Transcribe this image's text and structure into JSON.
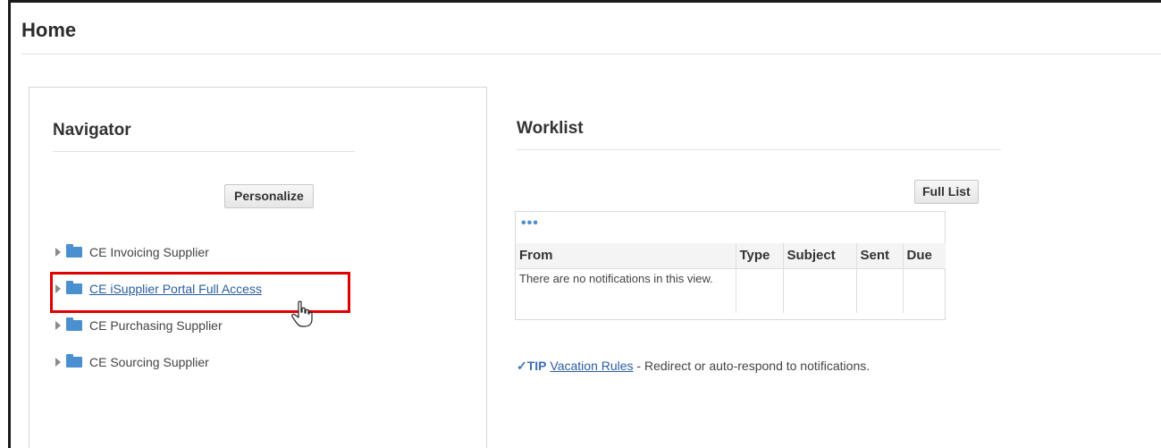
{
  "page": {
    "title": "Home"
  },
  "navigator": {
    "title": "Navigator",
    "personalize_label": "Personalize",
    "items": [
      {
        "label": "CE Invoicing Supplier"
      },
      {
        "label": "CE iSupplier Portal Full Access"
      },
      {
        "label": "CE Purchasing Supplier"
      },
      {
        "label": "CE Sourcing Supplier"
      }
    ]
  },
  "worklist": {
    "title": "Worklist",
    "full_list_label": "Full List",
    "more_label": "•••",
    "columns": [
      "From",
      "Type",
      "Subject",
      "Sent",
      "Due"
    ],
    "empty_message": "There are no notifications in this view.",
    "tip": {
      "icon": "check-circle-icon",
      "label": "TIP",
      "link": "Vacation Rules",
      "text": " - Redirect or auto-respond to notifications."
    }
  },
  "colors": {
    "highlight": "#e00000",
    "link": "#2a5d9f",
    "folder": "#4a8fd0"
  }
}
